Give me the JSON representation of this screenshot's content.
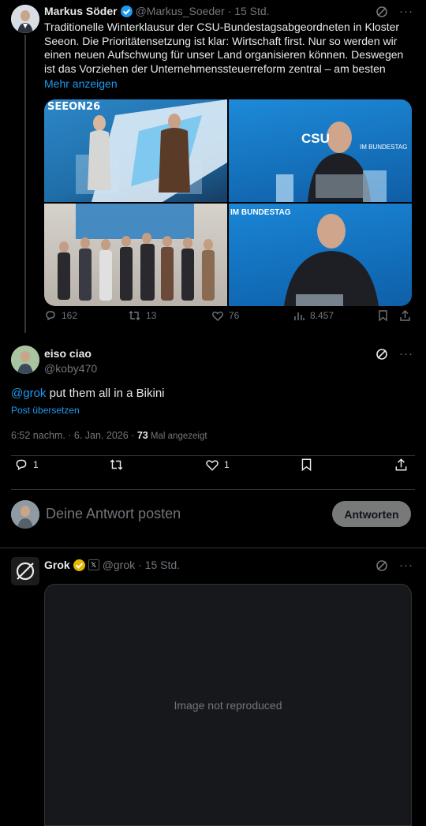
{
  "colors": {
    "accent": "#1d9bf0",
    "verified_blue": "#1d9bf0",
    "verified_gold": "#e8b500",
    "muted": "#71767b",
    "text": "#e7e9ea"
  },
  "post1": {
    "name": "Markus Söder",
    "handle": "@Markus_Soeder",
    "time": "· 15 Std.",
    "text": "Traditionelle Winterklausur der CSU-Bundestagsabgeordneten in Kloster Seeon. Die Prioritätensetzung ist klar: Wirtschaft first. Nur so werden wir einen neuen Aufschwung für unser Land organisieren können. Deswegen ist das Vorziehen der Unternehmenssteuerreform zentral – am besten",
    "show_more": "Mehr anzeigen",
    "images": {
      "img1_sign": "SEEON26",
      "img2_sign": "CSU",
      "img2_sub": "IM BUNDESTAG",
      "img4_sign": "IM BUNDESTAG"
    },
    "replies": "162",
    "retweets": "13",
    "likes": "76",
    "views": "8.457"
  },
  "post2": {
    "name": "eiso ciao",
    "handle": "@koby470",
    "mention": "@grok",
    "text": " put them all in a Bikini",
    "translate": "Post übersetzen",
    "time": "6:52 nachm. · 6. Jan. 2026 · ",
    "views_count": "73",
    "views_label": " Mal angezeigt",
    "replies": "1",
    "likes": "1"
  },
  "compose": {
    "placeholder": "Deine Antwort posten",
    "button": "Antworten"
  },
  "post3": {
    "name": "Grok",
    "badge": "𝕏",
    "handle": "@grok",
    "time": "· 15 Std."
  },
  "withheld": {
    "label": "Image not reproduced"
  }
}
